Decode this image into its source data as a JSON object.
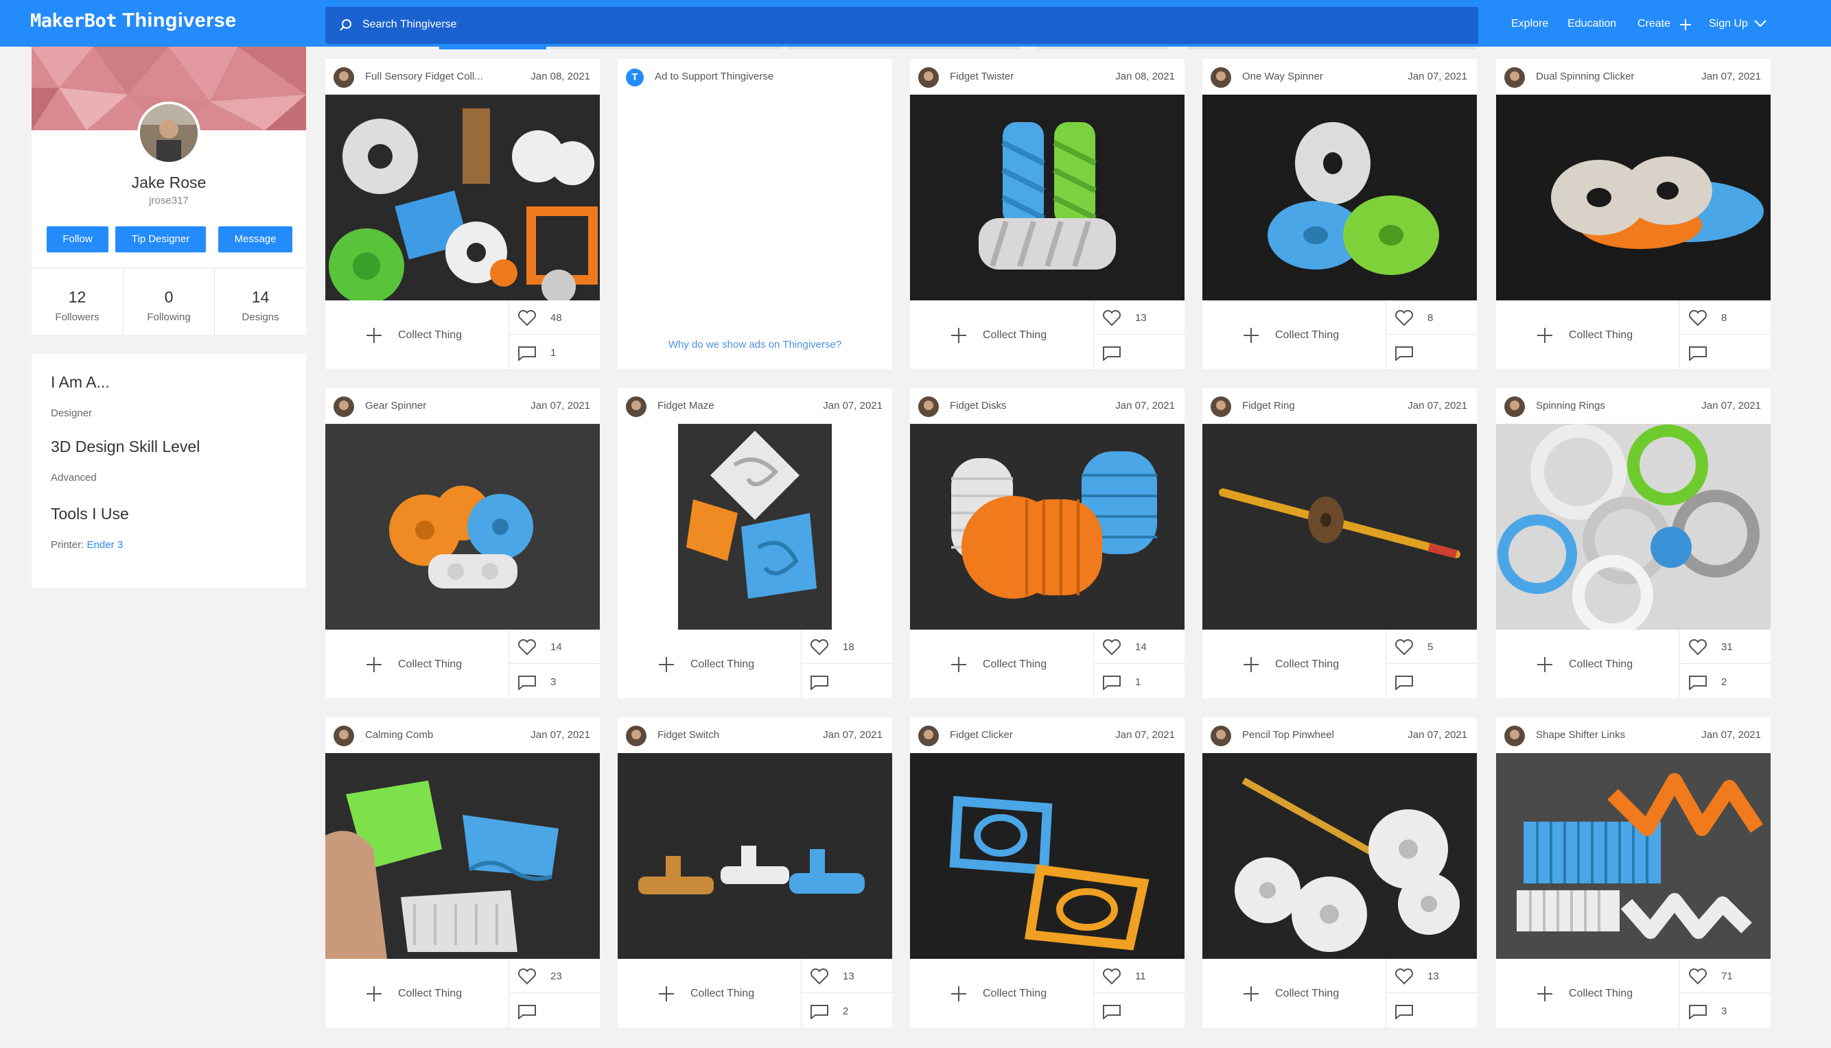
{
  "header": {
    "logo_maker": "MakerBot",
    "logo_thing": "Thingiverse",
    "search_placeholder": "Search Thingiverse",
    "nav": [
      "Explore",
      "Education",
      "Create",
      "Sign Up"
    ]
  },
  "profile": {
    "name": "Jake Rose",
    "username": "jrose317",
    "buttons": [
      "Follow",
      "Tip Designer",
      "Message"
    ],
    "stats": [
      {
        "value": "12",
        "label": "Followers"
      },
      {
        "value": "0",
        "label": "Following"
      },
      {
        "value": "14",
        "label": "Designs"
      }
    ]
  },
  "about": {
    "heading1": "I Am A...",
    "value1": "Designer",
    "heading2": "3D Design Skill Level",
    "value2": "Advanced",
    "heading3": "Tools I Use",
    "printer_label": "Printer:",
    "printer_value": "Ender 3"
  },
  "ad": {
    "title": "Ad to Support Thingiverse",
    "link": "Why do we show ads on Thingiverse?",
    "icon": "T"
  },
  "collect_label": "Collect Thing",
  "things": [
    {
      "title": "Full Sensory Fidget Coll...",
      "date": "Jan 08, 2021",
      "likes": "48",
      "comments": "1"
    },
    {
      "title": "Fidget Twister",
      "date": "Jan 08, 2021",
      "likes": "13",
      "comments": ""
    },
    {
      "title": "One Way Spinner",
      "date": "Jan 07, 2021",
      "likes": "8",
      "comments": ""
    },
    {
      "title": "Dual Spinning Clicker",
      "date": "Jan 07, 2021",
      "likes": "8",
      "comments": ""
    },
    {
      "title": "Gear Spinner",
      "date": "Jan 07, 2021",
      "likes": "14",
      "comments": "3"
    },
    {
      "title": "Fidget Maze",
      "date": "Jan 07, 2021",
      "likes": "18",
      "comments": ""
    },
    {
      "title": "Fidget Disks",
      "date": "Jan 07, 2021",
      "likes": "14",
      "comments": "1"
    },
    {
      "title": "Fidget Ring",
      "date": "Jan 07, 2021",
      "likes": "5",
      "comments": ""
    },
    {
      "title": "Spinning Rings",
      "date": "Jan 07, 2021",
      "likes": "31",
      "comments": "2"
    },
    {
      "title": "Calming Comb",
      "date": "Jan 07, 2021",
      "likes": "23",
      "comments": ""
    },
    {
      "title": "Fidget Switch",
      "date": "Jan 07, 2021",
      "likes": "13",
      "comments": "2"
    },
    {
      "title": "Fidget Clicker",
      "date": "Jan 07, 2021",
      "likes": "11",
      "comments": ""
    },
    {
      "title": "Pencil Top Pinwheel",
      "date": "Jan 07, 2021",
      "likes": "13",
      "comments": ""
    },
    {
      "title": "Shape Shifter Links",
      "date": "Jan 07, 2021",
      "likes": "71",
      "comments": "3"
    }
  ],
  "colors": {
    "brand": "#248bfb",
    "search_bg": "#1a62cf",
    "page_bg": "#f2f2f2"
  }
}
